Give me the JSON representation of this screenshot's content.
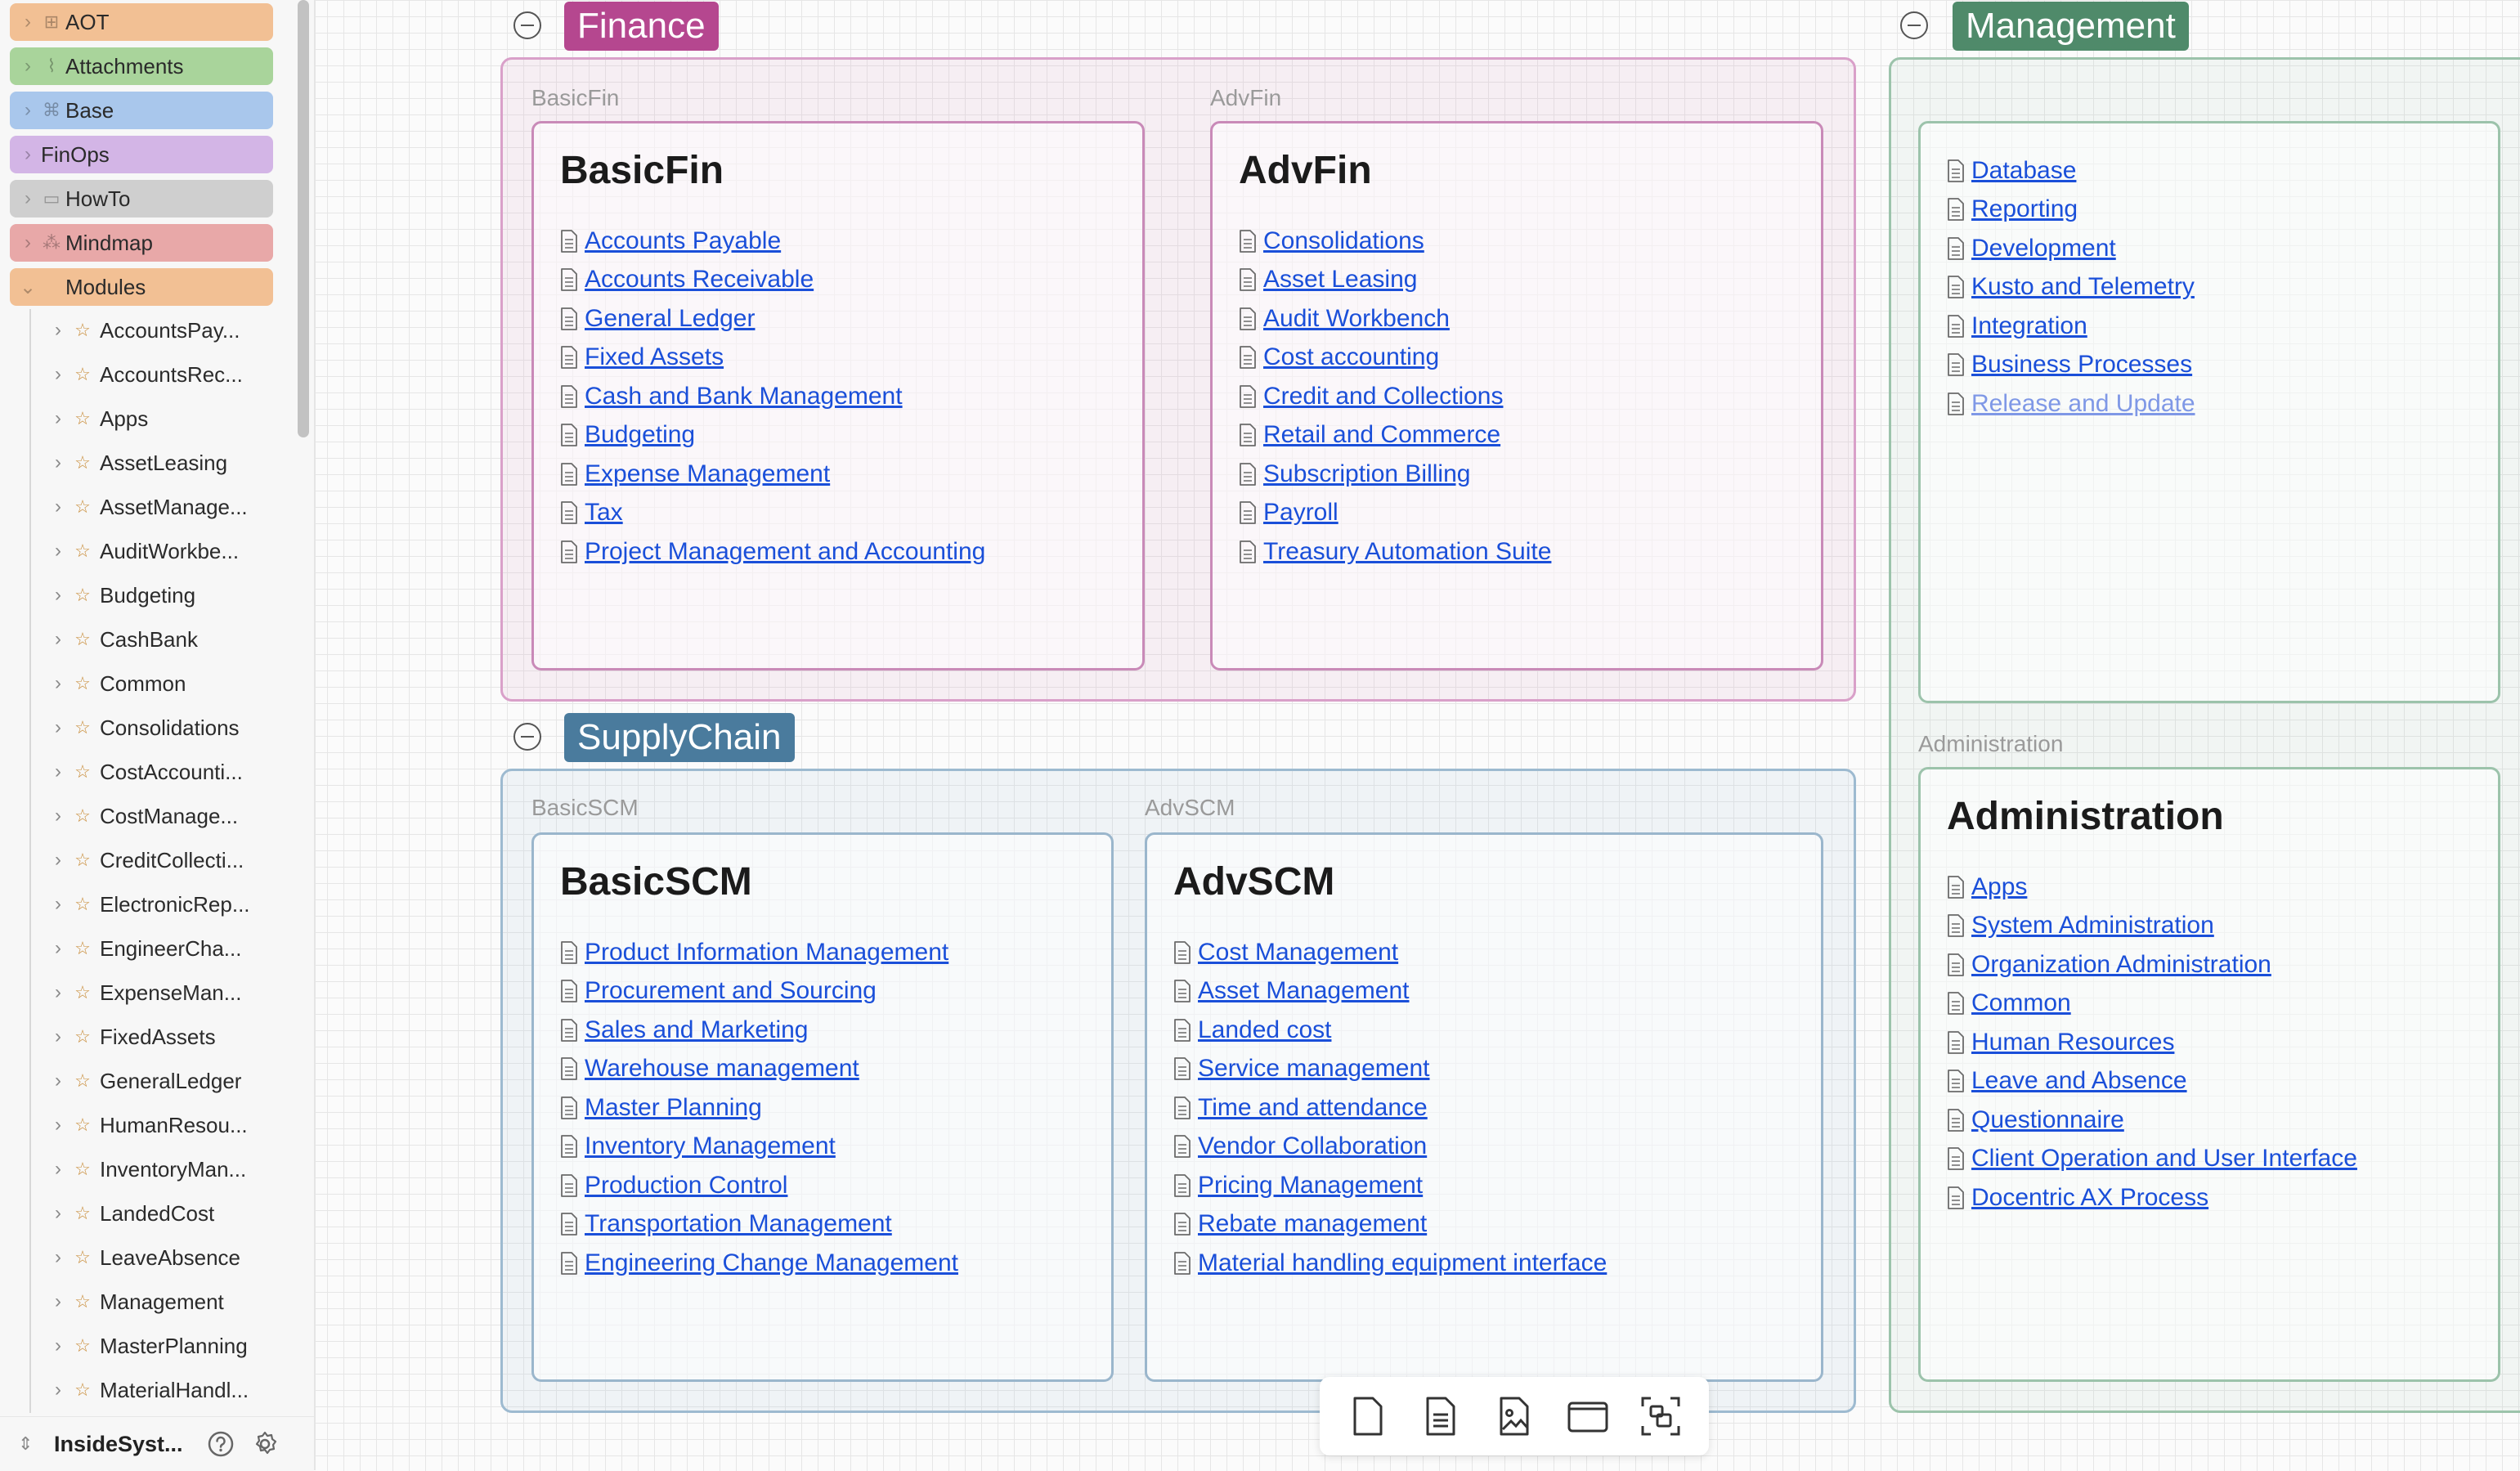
{
  "sidebar": {
    "pills": [
      {
        "label": "AOT",
        "color": "#f2c094"
      },
      {
        "label": "Attachments",
        "color": "#a9d49b"
      },
      {
        "label": "Base",
        "color": "#a9c7ec"
      },
      {
        "label": "FinOps",
        "color": "#d3b5e6"
      },
      {
        "label": "HowTo",
        "color": "#cfcfcf"
      },
      {
        "label": "Mindmap",
        "color": "#e8a8a8"
      },
      {
        "label": "Modules",
        "color": "#f2c094"
      }
    ],
    "modules": [
      "AccountsPay...",
      "AccountsRec...",
      "Apps",
      "AssetLeasing",
      "AssetManage...",
      "AuditWorkbe...",
      "Budgeting",
      "CashBank",
      "Common",
      "Consolidations",
      "CostAccounti...",
      "CostManage...",
      "CreditCollecti...",
      "ElectronicRep...",
      "EngineerCha...",
      "ExpenseMan...",
      "FixedAssets",
      "GeneralLedger",
      "HumanResou...",
      "InventoryMan...",
      "LandedCost",
      "LeaveAbsence",
      "Management",
      "MasterPlanning",
      "MaterialHandl..."
    ],
    "footer": {
      "vault_name": "InsideSyst..."
    }
  },
  "canvas": {
    "finance": {
      "title": "Finance",
      "color": "#b5478f",
      "basic": {
        "label": "BasicFin",
        "title": "BasicFin",
        "links": [
          "Accounts Payable",
          "Accounts Receivable",
          "General Ledger",
          "Fixed Assets",
          "Cash and Bank Management",
          "Budgeting",
          "Expense Management",
          "Tax",
          "Project Management and Accounting"
        ]
      },
      "adv": {
        "label": "AdvFin",
        "title": "AdvFin",
        "links": [
          "Consolidations",
          "Asset Leasing",
          "Audit Workbench",
          "Cost accounting",
          "Credit and Collections",
          "Retail and Commerce",
          "Subscription Billing",
          "Payroll",
          "Treasury Automation Suite"
        ]
      }
    },
    "supplychain": {
      "title": "SupplyChain",
      "color": "#4a7b9d",
      "basic": {
        "label": "BasicSCM",
        "title": "BasicSCM",
        "links": [
          "Product Information Management",
          "Procurement and Sourcing",
          "Sales and Marketing",
          "Warehouse management",
          "Master Planning",
          "Inventory Management",
          "Production Control",
          "Transportation Management",
          "Engineering Change Management"
        ]
      },
      "adv": {
        "label": "AdvSCM",
        "title": "AdvSCM",
        "links": [
          "Cost Management",
          "Asset Management",
          "Landed cost",
          "Service management",
          "Time and attendance",
          "Vendor Collaboration",
          "Pricing Management",
          "Rebate management",
          "Material handling equipment interface"
        ]
      }
    },
    "management": {
      "title": "Management",
      "color": "#4f8a6a",
      "links": [
        "Database",
        "Reporting",
        "Development",
        "Kusto and Telemetry",
        "Integration",
        "Business Processes",
        "Release and Update"
      ],
      "administration": {
        "label": "Administration",
        "title": "Administration",
        "links": [
          "Apps",
          "System Administration",
          "Organization Administration",
          "Common",
          "Human Resources",
          "Leave and Absence",
          "Questionnaire",
          "Client Operation and User Interface",
          "Docentric AX Process"
        ]
      }
    }
  }
}
